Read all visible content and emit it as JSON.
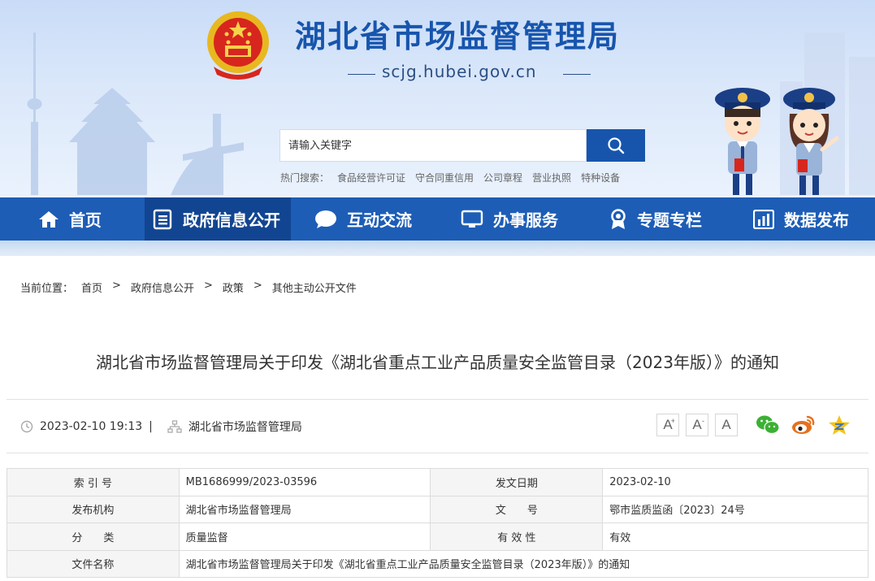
{
  "header": {
    "site_title": "湖北省市场监督管理局",
    "site_domain": "scjg.hubei.gov.cn"
  },
  "search": {
    "placeholder": "请输入关键字",
    "hot_label": "热门搜索：",
    "hot_items": [
      "食品经营许可证",
      "守合同重信用",
      "公司章程",
      "营业执照",
      "特种设备"
    ]
  },
  "nav": {
    "items": [
      {
        "label": "首页",
        "icon": "home-icon"
      },
      {
        "label": "政府信息公开",
        "icon": "document-list-icon"
      },
      {
        "label": "互动交流",
        "icon": "chat-bubble-icon"
      },
      {
        "label": "办事服务",
        "icon": "monitor-icon"
      },
      {
        "label": "专题专栏",
        "icon": "badge-icon"
      },
      {
        "label": "数据发布",
        "icon": "bar-chart-icon"
      }
    ],
    "active_index": 1
  },
  "breadcrumb": {
    "label": "当前位置：",
    "items": [
      "首页",
      "政府信息公开",
      "政策",
      "其他主动公开文件"
    ],
    "separator": ">"
  },
  "article": {
    "title": "湖北省市场监督管理局关于印发《湖北省重点工业产品质量安全监管目录（2023年版）》的通知",
    "datetime": "2023-02-10 19:13",
    "divider": "|",
    "source": "湖北省市场监督管理局"
  },
  "font_size_buttons": [
    {
      "label": "A",
      "sup": "+"
    },
    {
      "label": "A",
      "sup": "-"
    },
    {
      "label": "A",
      "sup": ""
    }
  ],
  "share": [
    "wechat-icon",
    "weibo-icon",
    "qzone-icon"
  ],
  "info_table": {
    "rows": [
      {
        "k1": "索 引 号",
        "v1": "MB1686999/2023-03596",
        "k2": "发文日期",
        "v2": "2023-02-10"
      },
      {
        "k1": "发布机构",
        "v1": "湖北省市场监督管理局",
        "k2": "文　　号",
        "v2": "鄂市监质监函〔2023〕24号"
      },
      {
        "k1": "分　　类",
        "v1": "质量监督",
        "k2": "有 效 性",
        "v2": "有效"
      }
    ],
    "name_row": {
      "k": "文件名称",
      "v": "湖北省市场监督管理局关于印发《湖北省重点工业产品质量安全监管目录（2023年版）》的通知"
    }
  },
  "colors": {
    "brand_blue": "#1d5db6",
    "nav_active": "#124591",
    "title_blue": "#1755ad",
    "wechat_green": "#3cb034",
    "weibo_orange": "#e6701d",
    "qzone_yellow": "#f4c21c"
  }
}
